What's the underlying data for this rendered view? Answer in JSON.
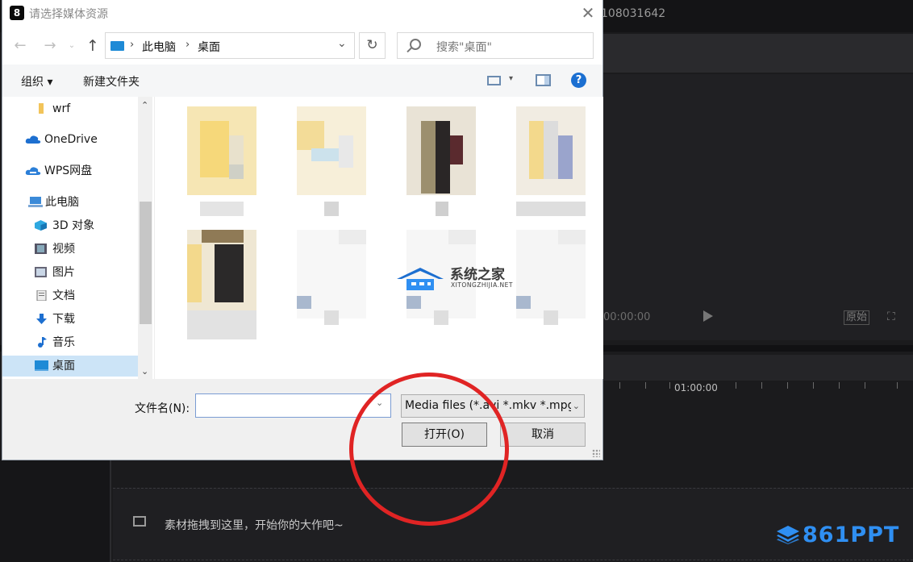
{
  "background": {
    "project_id": "108031642",
    "player_time": "00:00:00",
    "player_ratio_label": "原始",
    "timeline_ruler_label": "01:00:00",
    "track_placeholder": "素材拖拽到这里，开始你的大作吧~",
    "watermark_brand": "861PPT"
  },
  "dialog": {
    "title": "请选择媒体资源",
    "app_icon_glyph": "8",
    "close_glyph": "✕",
    "breadcrumb": [
      "此电脑",
      "桌面"
    ],
    "search_placeholder": "搜索\"桌面\"",
    "toolbar": {
      "organize": "组织 ▾",
      "new_folder": "新建文件夹",
      "help": "?"
    },
    "nav_items": [
      {
        "label": "wrf",
        "icon": "folder-icon"
      },
      {
        "label": "OneDrive",
        "icon": "cloud-icon"
      },
      {
        "label": "WPS网盘",
        "icon": "cloud-drive-icon"
      },
      {
        "label": "此电脑",
        "icon": "computer-icon"
      },
      {
        "label": "3D 对象",
        "icon": "cube-icon"
      },
      {
        "label": "视频",
        "icon": "video-icon"
      },
      {
        "label": "图片",
        "icon": "picture-icon"
      },
      {
        "label": "文档",
        "icon": "document-icon"
      },
      {
        "label": "下载",
        "icon": "download-icon"
      },
      {
        "label": "音乐",
        "icon": "music-icon"
      },
      {
        "label": "桌面",
        "icon": "desktop-icon",
        "selected": true
      }
    ],
    "filename_label": "文件名(N):",
    "filename_value": "",
    "filetype_value": "Media files (*.avi *.mkv *.mpg",
    "open_button": "打开(O)",
    "cancel_button": "取消"
  },
  "watermark": {
    "name": "系统之家",
    "url": "XITONGZHIJIA.NET"
  },
  "colors": {
    "accent": "#1b6fd1",
    "selection": "#cce4f7",
    "annotation": "#e02424",
    "brand": "#2f8ff2"
  }
}
